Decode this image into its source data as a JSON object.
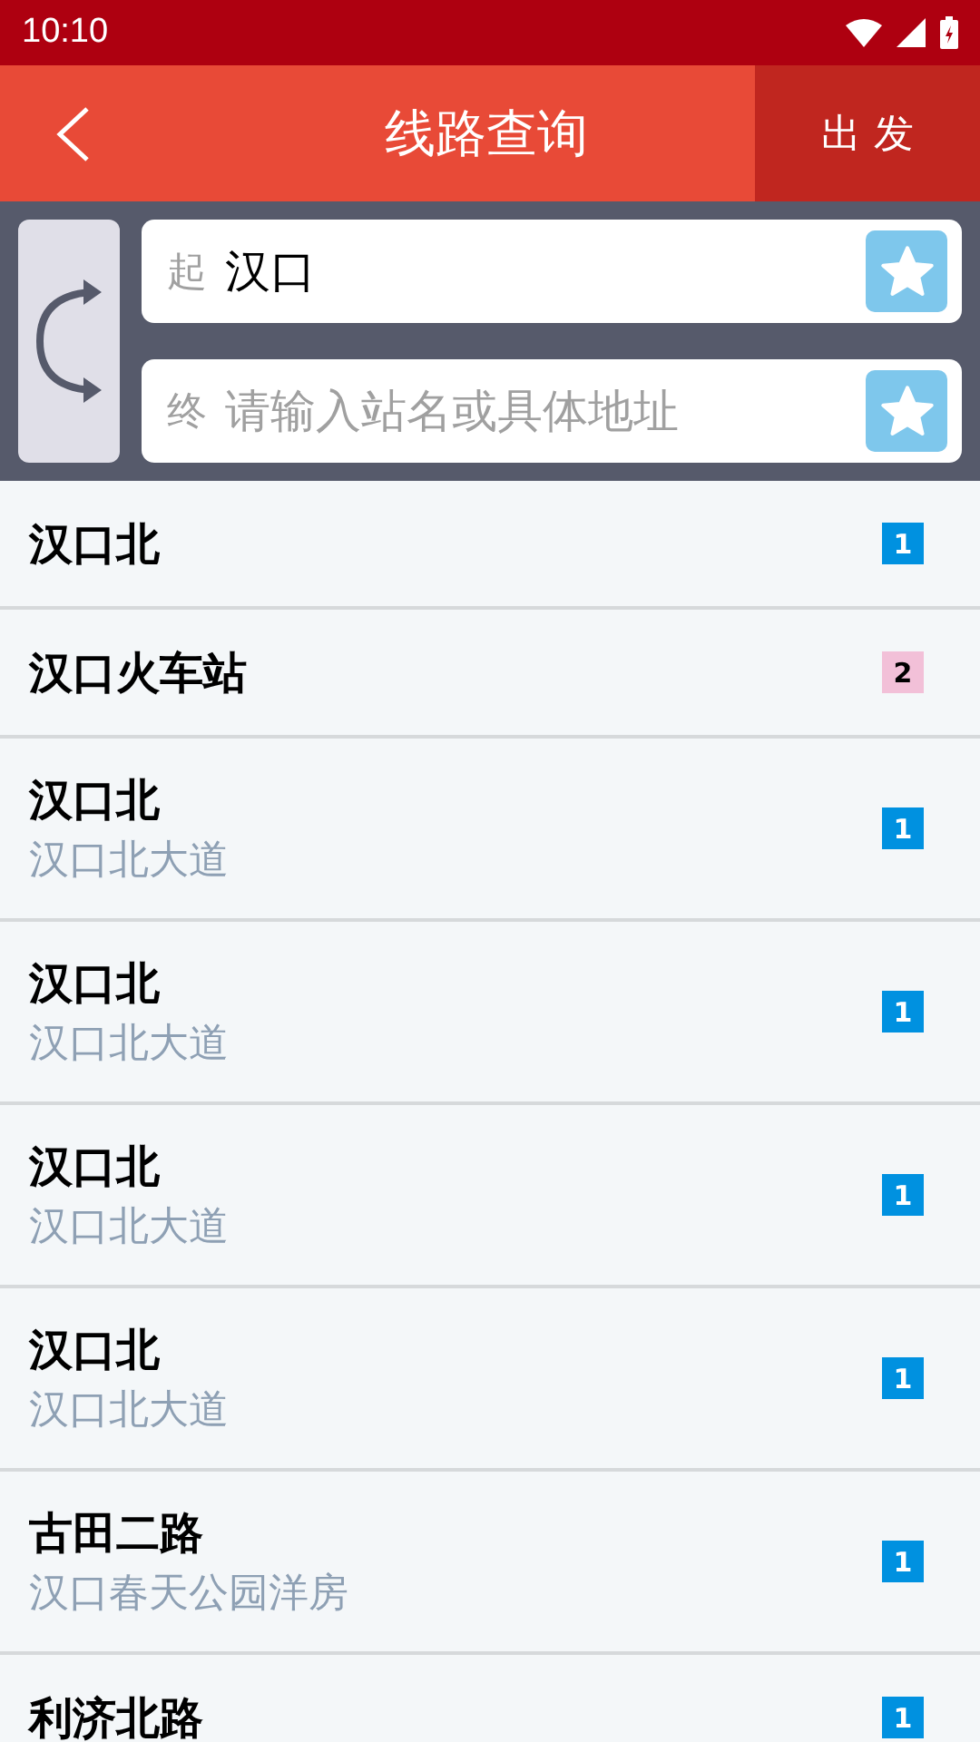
{
  "status_bar": {
    "time": "10:10"
  },
  "header": {
    "title": "线路查询",
    "action": "出 发"
  },
  "search": {
    "from": {
      "label": "起",
      "value": "汉口"
    },
    "to": {
      "label": "终",
      "placeholder": "请输入站名或具体地址"
    }
  },
  "results": [
    {
      "name": "汉口北",
      "badge": "1",
      "color": "#0091e0"
    },
    {
      "name": "汉口火车站",
      "badge": "2",
      "color": "#f2c0d8"
    },
    {
      "name": "汉口北",
      "address": "汉口北大道",
      "badge": "1",
      "color": "#0091e0"
    },
    {
      "name": "汉口北",
      "address": "汉口北大道",
      "badge": "1",
      "color": "#0091e0"
    },
    {
      "name": "汉口北",
      "address": "汉口北大道",
      "badge": "1",
      "color": "#0091e0"
    },
    {
      "name": "汉口北",
      "address": "汉口北大道",
      "badge": "1",
      "color": "#0091e0"
    },
    {
      "name": "古田二路",
      "address": "汉口春天公园洋房",
      "badge": "1",
      "color": "#0091e0"
    },
    {
      "name": "利济北路",
      "badge": "1",
      "color": "#0091e0"
    }
  ]
}
